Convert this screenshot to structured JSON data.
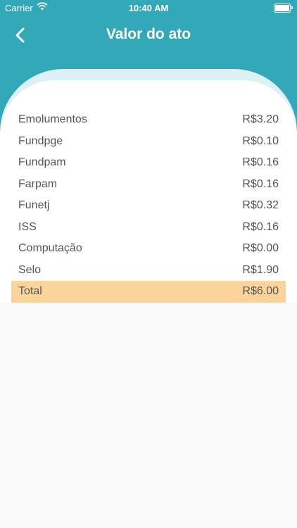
{
  "status_bar": {
    "carrier": "Carrier",
    "time": "10:40 AM"
  },
  "nav": {
    "title": "Valor do ato"
  },
  "colors": {
    "header": "#33a8b8",
    "total_highlight": "#fcd49b"
  },
  "fees": [
    {
      "label": "Emolumentos",
      "value": "R$3.20"
    },
    {
      "label": "Fundpge",
      "value": "R$0.10"
    },
    {
      "label": "Fundpam",
      "value": "R$0.16"
    },
    {
      "label": "Farpam",
      "value": "R$0.16"
    },
    {
      "label": "Funetj",
      "value": "R$0.32"
    },
    {
      "label": "ISS",
      "value": "R$0.16"
    },
    {
      "label": "Computação",
      "value": "R$0.00"
    },
    {
      "label": "Selo",
      "value": "R$1.90"
    }
  ],
  "total": {
    "label": "Total",
    "value": "R$6.00"
  }
}
